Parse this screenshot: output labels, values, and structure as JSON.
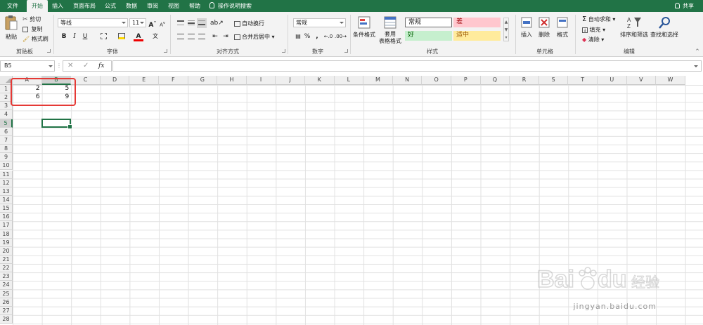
{
  "tabs": [
    "文件",
    "开始",
    "插入",
    "页面布局",
    "公式",
    "数据",
    "审阅",
    "视图",
    "帮助"
  ],
  "active_tab": "开始",
  "search_label": "操作说明搜索",
  "share_label": "共享",
  "ribbon": {
    "clipboard": {
      "paste": "粘贴",
      "cut": "剪切",
      "copy": "复制",
      "format_painter": "格式刷",
      "label": "剪贴板"
    },
    "font": {
      "font_name": "等线",
      "font_size": "11",
      "bold": "B",
      "italic": "I",
      "underline": "U",
      "grow": "A",
      "shrink": "A",
      "label": "字体"
    },
    "alignment": {
      "wrap": "自动换行",
      "merge": "合并后居中",
      "label": "对齐方式"
    },
    "number": {
      "format": "常规",
      "percent": "%",
      "comma": ",",
      "label": "数字"
    },
    "styles": {
      "conditional": "条件格式",
      "table_format_1": "套用",
      "table_format_2": "表格格式",
      "normal": "常规",
      "bad": "差",
      "good": "好",
      "neutral": "适中",
      "label": "样式"
    },
    "cells": {
      "insert": "插入",
      "delete": "删除",
      "format": "格式",
      "label": "单元格"
    },
    "editing": {
      "autosum": "自动求和",
      "fill": "填充",
      "clear": "清除",
      "sort": "排序和筛选",
      "find": "查找和选择",
      "label": "编辑"
    }
  },
  "colors": {
    "brand": "#217346",
    "bad_fill": "#ffc7ce",
    "bad_text": "#9c0006",
    "good_fill": "#c6efce",
    "good_text": "#006100",
    "neutral_fill": "#ffeb9c",
    "neutral_text": "#9c5700",
    "highlight": "#e53935"
  },
  "formula_bar": {
    "name_box": "B5",
    "fx": "fx",
    "formula": ""
  },
  "grid": {
    "columns": [
      "A",
      "B",
      "C",
      "D",
      "E",
      "F",
      "G",
      "H",
      "I",
      "J",
      "K",
      "L",
      "M",
      "N",
      "O",
      "P",
      "Q",
      "R",
      "S",
      "T",
      "U",
      "V",
      "W"
    ],
    "rows": [
      "1",
      "2",
      "3",
      "4",
      "5",
      "6",
      "7",
      "8",
      "9",
      "10",
      "11",
      "12",
      "13",
      "14",
      "15",
      "16",
      "17",
      "18",
      "19",
      "20",
      "21",
      "22",
      "23",
      "24",
      "25",
      "26",
      "27",
      "28"
    ],
    "selected_column": "B",
    "selected_row": "5",
    "cells": {
      "A1": "2",
      "B1": "5",
      "A2": "6",
      "B2": "9"
    }
  },
  "watermark": {
    "text": "Bai du 经验",
    "sub": "jingyan.baidu.com"
  }
}
